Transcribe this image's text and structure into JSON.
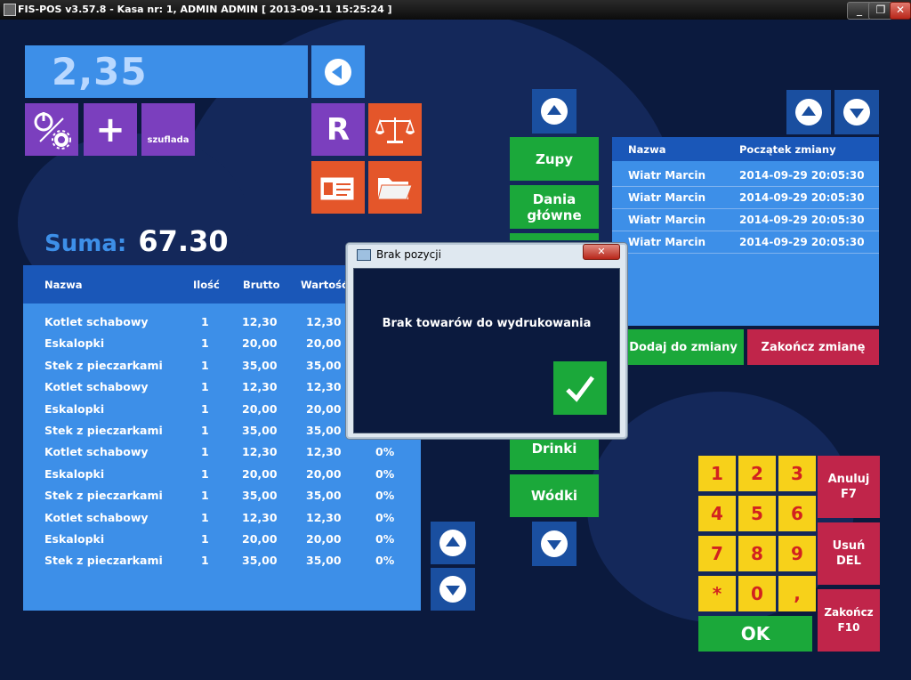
{
  "window": {
    "title": "FIS-POS v3.57.8 - Kasa nr: 1, ADMIN ADMIN [ 2013-09-11 15:25:24 ]",
    "min_label": "_",
    "max_label": "❐",
    "close_label": "✕"
  },
  "display": {
    "amount": "2,35"
  },
  "tiles": {
    "drawer_label": "szuflada",
    "r_label": "R",
    "plus_label": "+"
  },
  "sum": {
    "label": "Suma:",
    "value": "67.30"
  },
  "order": {
    "columns": [
      "Nazwa",
      "Ilość",
      "Brutto",
      "Wartość"
    ],
    "rows": [
      [
        "Kotlet schabowy",
        "1",
        "12,30",
        "12,30",
        ""
      ],
      [
        "Eskalopki",
        "1",
        "20,00",
        "20,00",
        ""
      ],
      [
        "Stek z pieczarkami",
        "1",
        "35,00",
        "35,00",
        ""
      ],
      [
        "Kotlet schabowy",
        "1",
        "12,30",
        "12,30",
        ""
      ],
      [
        "Eskalopki",
        "1",
        "20,00",
        "20,00",
        ""
      ],
      [
        "Stek z pieczarkami",
        "1",
        "35,00",
        "35,00",
        ""
      ],
      [
        "Kotlet schabowy",
        "1",
        "12,30",
        "12,30",
        "0%"
      ],
      [
        "Eskalopki",
        "1",
        "20,00",
        "20,00",
        "0%"
      ],
      [
        "Stek z pieczarkami",
        "1",
        "35,00",
        "35,00",
        "0%"
      ],
      [
        "Kotlet schabowy",
        "1",
        "12,30",
        "12,30",
        "0%"
      ],
      [
        "Eskalopki",
        "1",
        "20,00",
        "20,00",
        "0%"
      ],
      [
        "Stek z pieczarkami",
        "1",
        "35,00",
        "35,00",
        "0%"
      ]
    ]
  },
  "categories": {
    "zupy": "Zupy",
    "dania": "Dania\ngłówne",
    "drinki": "Drinki",
    "wodki": "Wódki"
  },
  "shifts": {
    "columns": [
      "Nazwa",
      "Początek zmiany"
    ],
    "rows": [
      [
        "Wiatr Marcin",
        "2014-09-29 20:05:30"
      ],
      [
        "Wiatr Marcin",
        "2014-09-29 20:05:30"
      ],
      [
        "Wiatr Marcin",
        "2014-09-29 20:05:30"
      ],
      [
        "Wiatr Marcin",
        "2014-09-29 20:05:30"
      ]
    ],
    "add_label": "Dodaj do zmiany",
    "end_label": "Zakończ zmianę"
  },
  "keypad": {
    "keys": [
      "1",
      "2",
      "3",
      "4",
      "5",
      "6",
      "7",
      "8",
      "9",
      "*",
      "0",
      ","
    ],
    "cancel_label": "Anuluj\nF7",
    "delete_label": "Usuń\nDEL",
    "finish_label": "Zakończ\nF10",
    "ok_label": "OK"
  },
  "dialog": {
    "title": "Brak pozycji",
    "message": "Brak towarów do wydrukowania",
    "close_label": "✕"
  },
  "colors": {
    "background": "#0b1a3e",
    "tile_blue": "#3d8fe8",
    "purple": "#7b3fbe",
    "orange": "#e4562a",
    "green": "#1ba83a",
    "red": "#c0254a",
    "yellow": "#f7d11a"
  }
}
